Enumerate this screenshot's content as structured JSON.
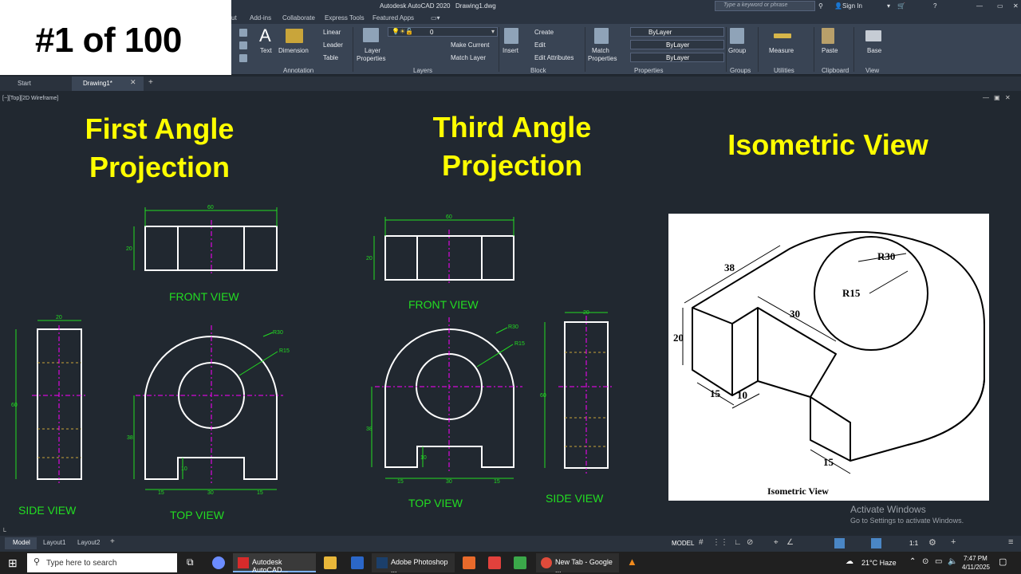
{
  "badge": {
    "text": "#1 of 100"
  },
  "titlebar": {
    "app_title": "Autodesk AutoCAD 2020",
    "file_name": "Drawing1.dwg",
    "search_placeholder": "Type a keyword or phrase",
    "sign_in": "Sign In"
  },
  "ribbon_tabs": [
    "ut",
    "Add-ins",
    "Collaborate",
    "Express Tools",
    "Featured Apps"
  ],
  "ribbon": {
    "annotation": {
      "text": "Text",
      "dimension": "Dimension",
      "linear": "Linear",
      "leader": "Leader",
      "table": "Table",
      "label": "Annotation"
    },
    "layers": {
      "layer_properties_1": "Layer",
      "layer_properties_2": "Properties",
      "layer_value": "0",
      "make_current": "Make Current",
      "match_layer": "Match Layer",
      "label": "Layers"
    },
    "block": {
      "insert": "Insert",
      "create": "Create",
      "edit": "Edit",
      "edit_attributes": "Edit Attributes",
      "label": "Block"
    },
    "properties": {
      "match_1": "Match",
      "match_2": "Properties",
      "color": "ByLayer",
      "linetype": "ByLayer",
      "lineweight": "ByLayer",
      "label": "Properties"
    },
    "groups": {
      "group": "Group",
      "label": "Groups"
    },
    "utilities": {
      "measure": "Measure",
      "label": "Utilities"
    },
    "clipboard": {
      "paste": "Paste",
      "label": "Clipboard"
    },
    "view": {
      "base": "Base",
      "label": "View"
    }
  },
  "file_tabs": {
    "start": "Start",
    "drawing": "Drawing1*"
  },
  "viewport": {
    "label": "[−][Top][2D Wireframe]",
    "headings": {
      "first": [
        "First Angle",
        "Projection"
      ],
      "third": [
        "Third Angle",
        "Projection"
      ],
      "iso": "Isometric View"
    },
    "labels": {
      "fa_front": "FRONT VIEW",
      "fa_side": "SIDE VIEW",
      "fa_top": "TOP VIEW",
      "ta_front": "FRONT VIEW",
      "ta_top": "TOP VIEW",
      "ta_side": "SIDE VIEW"
    },
    "dims": {
      "fa_front_w": "60",
      "fa_front_h": "20",
      "fa_side_w": "20",
      "fa_side_h": "60",
      "fa_top_r30": "R30",
      "fa_top_r15": "R15",
      "fa_top_h": "38",
      "fa_top_10": "10",
      "fa_top_15a": "15",
      "fa_top_30": "30",
      "fa_top_15b": "15",
      "ta_front_w": "60",
      "ta_front_h": "20",
      "ta_top_r30": "R30",
      "ta_top_r15": "R15",
      "ta_top_h": "38",
      "ta_top_10": "10",
      "ta_top_15a": "15",
      "ta_top_30": "30",
      "ta_top_15b": "15",
      "ta_side_w": "20",
      "ta_side_h": "60"
    },
    "iso": {
      "d38": "38",
      "r30": "R30",
      "r15": "R15",
      "d20": "20",
      "d30": "30",
      "d15a": "15",
      "d10": "10",
      "d15b": "15",
      "caption": "Isometric View"
    },
    "watermark": {
      "title": "Activate Windows",
      "subtitle": "Go to Settings to activate Windows."
    }
  },
  "layout_tabs": [
    "Model",
    "Layout1",
    "Layout2"
  ],
  "status": {
    "model": "MODEL",
    "scale": "1:1"
  },
  "taskbar": {
    "search": "Type here to search",
    "autocad": "Autodesk AutoCAD...",
    "photoshop": "Adobe Photoshop ...",
    "chrome": "New Tab - Google ...",
    "weather": "21°C  Haze",
    "time": "7:47 PM",
    "date": "4/11/2025"
  },
  "colors": {
    "yellow": "#ffff00",
    "green": "#22dd22",
    "magenta": "#ff00ff",
    "canvas": "#212830"
  }
}
